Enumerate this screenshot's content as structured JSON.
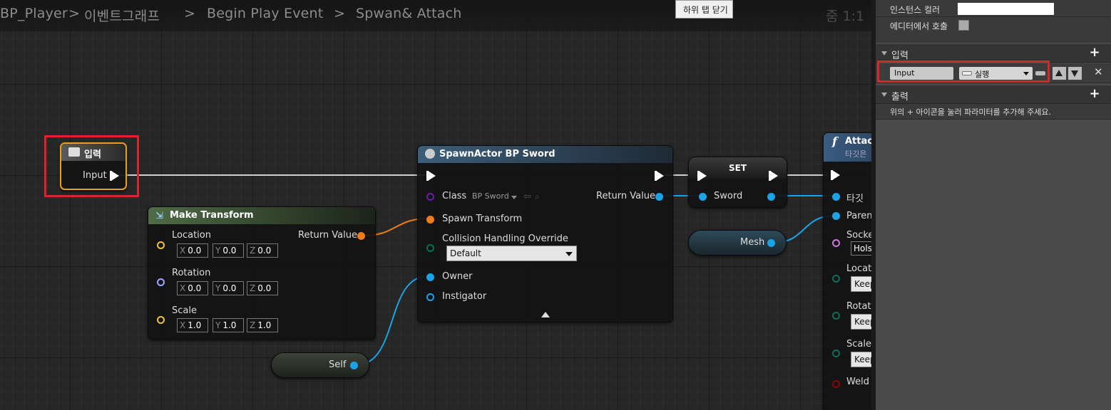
{
  "breadcrumb": {
    "items": [
      "BP_Player",
      "이벤트그래프",
      "Begin Play Event",
      "Spwan& Attach"
    ],
    "separator": ">",
    "zoom": "줌 1:1"
  },
  "tooltip": "하위 탭 닫기",
  "nodes": {
    "input_node": {
      "title": "입력",
      "pin": "Input"
    },
    "make_transform": {
      "title": "Make Transform",
      "location_label": "Location",
      "rotation_label": "Rotation",
      "scale_label": "Scale",
      "return_label": "Return Value",
      "axes": [
        "X",
        "Y",
        "Z"
      ],
      "location": [
        "0.0",
        "0.0",
        "0.0"
      ],
      "rotation": [
        "0.0",
        "0.0",
        "0.0"
      ],
      "scale": [
        "1.0",
        "1.0",
        "1.0"
      ]
    },
    "spawn_actor": {
      "title": "SpawnActor BP Sword",
      "class_label": "Class",
      "class_value": "BP Sword",
      "return_label": "Return Value",
      "spawn_transform_label": "Spawn Transform",
      "collision_label": "Collision Handling Override",
      "collision_value": "Default",
      "owner_label": "Owner",
      "instigator_label": "Instigator"
    },
    "set_node": {
      "title": "SET",
      "var_label": "Sword"
    },
    "self_node": {
      "label": "Self"
    },
    "mesh_node": {
      "label": "Mesh"
    },
    "attach_node": {
      "title": "Attac",
      "subtitle": "타깃은",
      "target_label": "타깃",
      "parent_label": "Paren",
      "socket_label": "Socke",
      "socket_value": "Hols",
      "location_label": "Locat",
      "location_value": "Keep",
      "rotation_label": "Rotat",
      "rotation_value": "Keep",
      "scale_label": "Scale",
      "scale_value": "Keep",
      "weld_label": "Weld S"
    }
  },
  "panel": {
    "instance_color_label": "인스턴스 컬러",
    "call_in_editor_label": "에디터에서 호출",
    "inputs_header": "입력",
    "input_param": {
      "name": "Input",
      "type": "실행"
    },
    "outputs_header": "출력",
    "outputs_hint": "위의 + 아이콘을 눌러 파라미터를 추가해 주세요."
  },
  "colors": {
    "exec": "#ffffff",
    "object_pin": "#1ba3e8",
    "transform_pin": "#f07b1a",
    "vector_pin": "#f4c131",
    "rotator_pin": "#9aa9ff",
    "class_pin": "#6a1fa8",
    "name_pin": "#c77bde",
    "enum_pin": "#0a6e5a",
    "bool_pin": "#950000",
    "highlight": "#e0222b"
  }
}
